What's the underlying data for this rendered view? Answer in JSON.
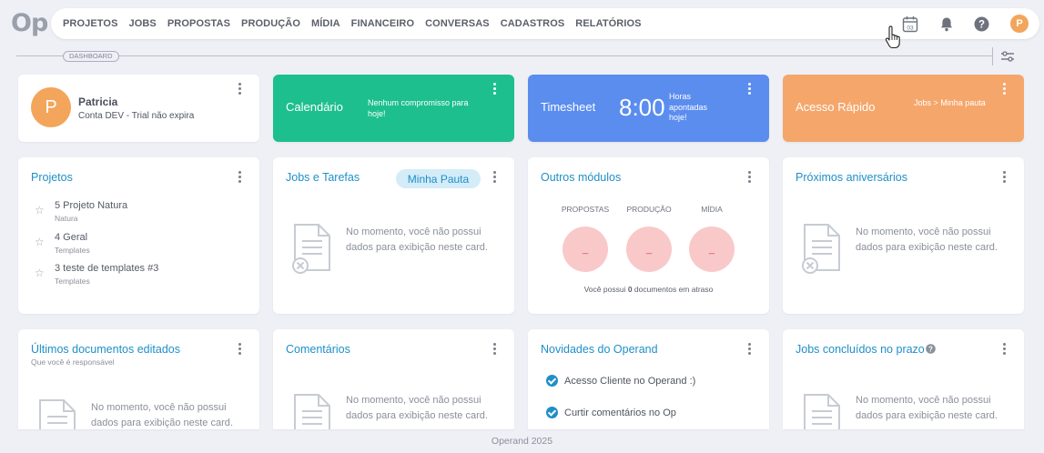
{
  "brand": {
    "logo": "Op"
  },
  "nav": {
    "items": [
      "PROJETOS",
      "JOBS",
      "PROPOSTAS",
      "PRODUÇÃO",
      "MÍDIA",
      "FINANCEIRO",
      "CONVERSAS",
      "CADASTROS",
      "RELATÓRIOS"
    ],
    "calendar_day": "03",
    "user_initial": "P"
  },
  "dashboard": {
    "label": "DASHBOARD"
  },
  "profile": {
    "initial": "P",
    "name": "Patricia",
    "account": "Conta DEV - Trial não expira"
  },
  "calendar_card": {
    "title": "Calendário",
    "message": "Nenhum compromisso para hoje!",
    "color": "#1dbf8e"
  },
  "timesheet_card": {
    "title": "Timesheet",
    "time": "8:00",
    "caption": "Horas apontadas hoje!",
    "color": "#5b8def"
  },
  "quick_access_card": {
    "title": "Acesso Rápido",
    "link": "Jobs > Minha pauta",
    "color": "#f5a66b"
  },
  "projects_card": {
    "title": "Projetos",
    "items": [
      {
        "name": "5 Projeto Natura",
        "sub": "Natura"
      },
      {
        "name": "4 Geral",
        "sub": "Templates"
      },
      {
        "name": "3 teste de templates #3",
        "sub": "Templates"
      }
    ]
  },
  "jobs_card": {
    "title": "Jobs e Tarefas",
    "pill": "Minha Pauta",
    "empty": "No momento, você não possui dados para exibição neste card."
  },
  "modules_card": {
    "title": "Outros módulos",
    "modules": [
      {
        "label": "PROPOSTAS",
        "value": "_"
      },
      {
        "label": "PRODUÇÃO",
        "value": "_"
      },
      {
        "label": "MÍDIA",
        "value": "_"
      }
    ],
    "note_prefix": "Você possui ",
    "note_count": "0",
    "note_suffix": " documentos em atraso"
  },
  "birthdays_card": {
    "title": "Próximos aniversários",
    "empty": "No momento, você não possui dados para exibição neste card."
  },
  "recent_docs_card": {
    "title": "Últimos documentos editados",
    "subtitle": "Que você é responsável",
    "empty": "No momento, você não possui dados para exibição neste card."
  },
  "comments_card": {
    "title": "Comentários",
    "empty": "No momento, você não possui dados para exibição neste card."
  },
  "news_card": {
    "title": "Novidades do Operand",
    "items": [
      "Acesso Cliente no Operand :)",
      "Curtir comentários no Op"
    ]
  },
  "ontime_card": {
    "title": "Jobs concluídos no prazo",
    "empty": "No momento, você não possui dados para exibição neste card."
  },
  "footer": {
    "text": "Operand 2025"
  }
}
